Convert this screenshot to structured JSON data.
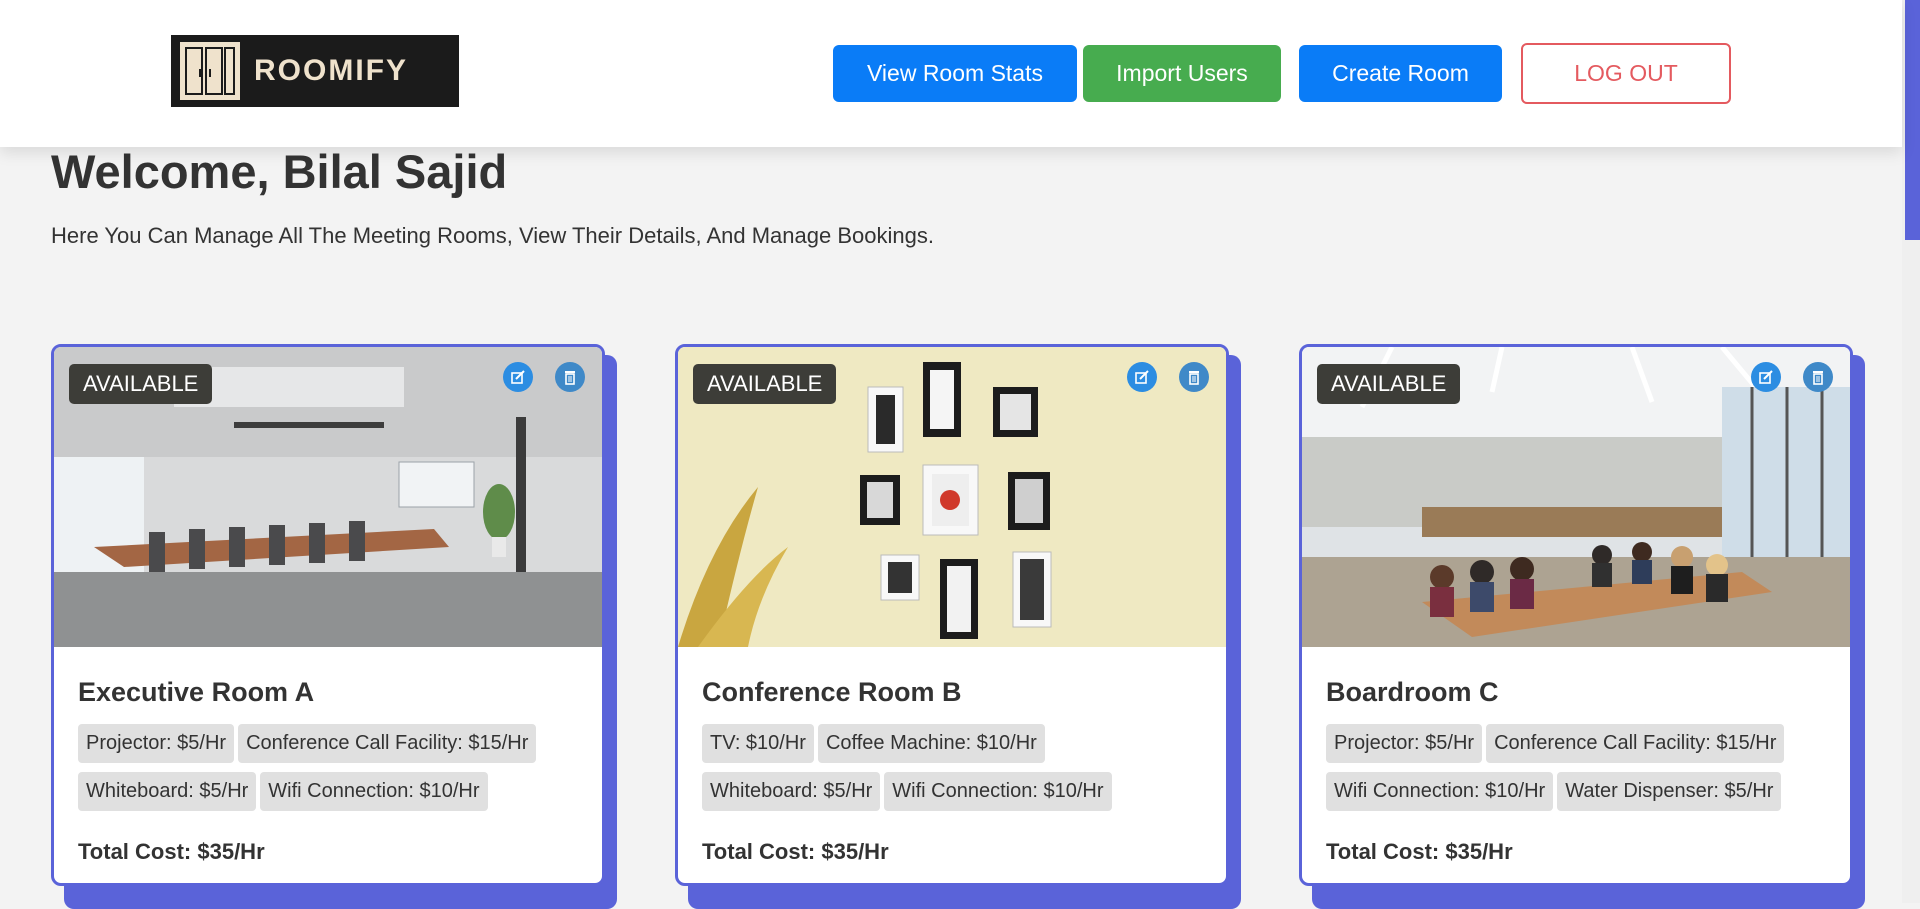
{
  "header": {
    "logo_text": "ROOMIFY",
    "buttons": {
      "view_stats": "View Room Stats",
      "import_users": "Import Users",
      "create_room": "Create Room",
      "logout": "LOG OUT"
    }
  },
  "main": {
    "welcome": "Welcome, Bilal Sajid",
    "subtitle": "Here You Can Manage All The Meeting Rooms, View Their Details, And Manage Bookings."
  },
  "rooms": [
    {
      "status": "AVAILABLE",
      "name": "Executive Room A",
      "facilities": [
        "Projector: $5/Hr",
        "Conference Call Facility: $15/Hr",
        "Whiteboard: $5/Hr",
        "Wifi Connection: $10/Hr"
      ],
      "total": "Total Cost: $35/Hr"
    },
    {
      "status": "AVAILABLE",
      "name": "Conference Room B",
      "facilities": [
        "TV: $10/Hr",
        "Coffee Machine: $10/Hr",
        "Whiteboard: $5/Hr",
        "Wifi Connection: $10/Hr"
      ],
      "total": "Total Cost: $35/Hr"
    },
    {
      "status": "AVAILABLE",
      "name": "Boardroom C",
      "facilities": [
        "Projector: $5/Hr",
        "Conference Call Facility: $15/Hr",
        "Wifi Connection: $10/Hr",
        "Water Dispenser: $5/Hr"
      ],
      "total": "Total Cost: $35/Hr"
    }
  ],
  "colors": {
    "accent": "#5a63d9",
    "primary_button": "#0a7cf7",
    "import_button": "#47ac4f",
    "logout": "#e45a5f"
  },
  "icons": [
    "edit-icon",
    "trash-icon"
  ]
}
